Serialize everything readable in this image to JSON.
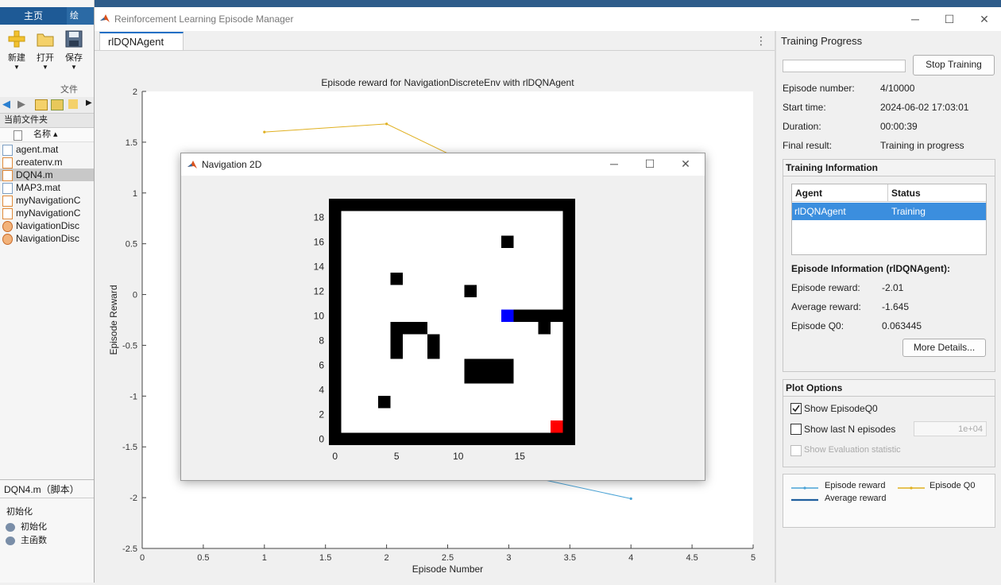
{
  "matlab": {
    "home_tab": "主页",
    "toolbar": [
      {
        "label": "新建",
        "icon": "plus-icon"
      },
      {
        "label": "打开",
        "icon": "folder-icon"
      },
      {
        "label": "保存",
        "icon": "save-icon"
      }
    ],
    "file_section": "文件",
    "current_folder": "当前文件夹",
    "name_column": "名称 ▴",
    "files": [
      {
        "name": "agent.mat",
        "icon": "mat-file-icon",
        "selected": false
      },
      {
        "name": "createnv.m",
        "icon": "script-file-icon",
        "selected": false
      },
      {
        "name": "DQN4.m",
        "icon": "script-file-icon",
        "selected": true
      },
      {
        "name": "MAP3.mat",
        "icon": "mat-file-icon",
        "selected": false
      },
      {
        "name": "myNavigationC",
        "icon": "script-file-icon",
        "selected": false
      },
      {
        "name": "myNavigationC",
        "icon": "script-file-icon",
        "selected": false
      },
      {
        "name": "NavigationDisc",
        "icon": "class-file-icon",
        "selected": false
      },
      {
        "name": "NavigationDisc",
        "icon": "class-file-icon",
        "selected": false
      }
    ],
    "detail_title": "DQN4.m（脚本）",
    "detail_section": "初始化",
    "detail_items": [
      "初始化",
      "主函数"
    ]
  },
  "manager": {
    "title": "Reinforcement Learning Episode Manager",
    "tab": "rlDQNAgent",
    "progress_title": "Training Progress",
    "stop_button": "Stop Training",
    "progress_fraction": 0.0004,
    "fields": [
      {
        "label": "Episode number:",
        "value": "4/10000"
      },
      {
        "label": "Start time:",
        "value": "2024-06-02 17:03:01"
      },
      {
        "label": "Duration:",
        "value": "00:00:39"
      },
      {
        "label": "Final result:",
        "value": "Training in progress"
      }
    ],
    "training_info": {
      "title": "Training Information",
      "headers": [
        "Agent",
        "Status"
      ],
      "rows": [
        {
          "agent": "rlDQNAgent",
          "status": "Training"
        }
      ]
    },
    "episode_info": {
      "title": "Episode Information (rlDQNAgent):",
      "fields": [
        {
          "label": "Episode reward:",
          "value": "-2.01"
        },
        {
          "label": "Average reward:",
          "value": "-1.645"
        },
        {
          "label": "Episode Q0:",
          "value": "0.063445"
        }
      ],
      "more_button": "More Details..."
    },
    "plot_options": {
      "title": "Plot Options",
      "show_q0": {
        "label": "Show EpisodeQ0",
        "checked": true
      },
      "show_last_n": {
        "label": "Show last N episodes",
        "checked": false,
        "value": "1e+04"
      },
      "show_eval": {
        "label": "Show Evaluation statistic",
        "checked": false
      }
    },
    "legend": [
      {
        "label": "Episode reward",
        "color": "#4aa3d6"
      },
      {
        "label": "Episode Q0",
        "color": "#e0b020"
      },
      {
        "label": "Average reward",
        "color": "#1f5f9e"
      }
    ]
  },
  "navigation_window": {
    "title": "Navigation 2D",
    "xticks": [
      "0",
      "5",
      "10",
      "15"
    ],
    "yticks": [
      "0",
      "2",
      "4",
      "6",
      "8",
      "10",
      "12",
      "14",
      "16",
      "18"
    ],
    "agent_color": "#0000ff",
    "goal_color": "#ff0000"
  },
  "chart_data": {
    "type": "line",
    "title": "Episode reward for NavigationDiscreteEnv with rlDQNAgent",
    "xlabel": "Episode Number",
    "ylabel": "Episode Reward",
    "xlim": [
      0,
      5
    ],
    "ylim": [
      -2.5,
      2
    ],
    "xticks": [
      "0",
      "0.5",
      "1",
      "1.5",
      "2",
      "2.5",
      "3",
      "3.5",
      "4",
      "4.5",
      "5"
    ],
    "yticks": [
      "-2.5",
      "-2",
      "-1.5",
      "-1",
      "-0.5",
      "0",
      "0.5",
      "1",
      "1.5",
      "2"
    ],
    "series": [
      {
        "name": "Episode Q0",
        "color": "#e0b020",
        "x": [
          1,
          2,
          3,
          4
        ],
        "y": [
          1.6,
          1.68,
          1.1,
          0.06
        ]
      },
      {
        "name": "Episode reward",
        "color": "#4aa3d6",
        "x": [
          1,
          2,
          3,
          4
        ],
        "y": [
          -1.3,
          -1.6,
          -1.75,
          -2.01
        ]
      }
    ]
  }
}
